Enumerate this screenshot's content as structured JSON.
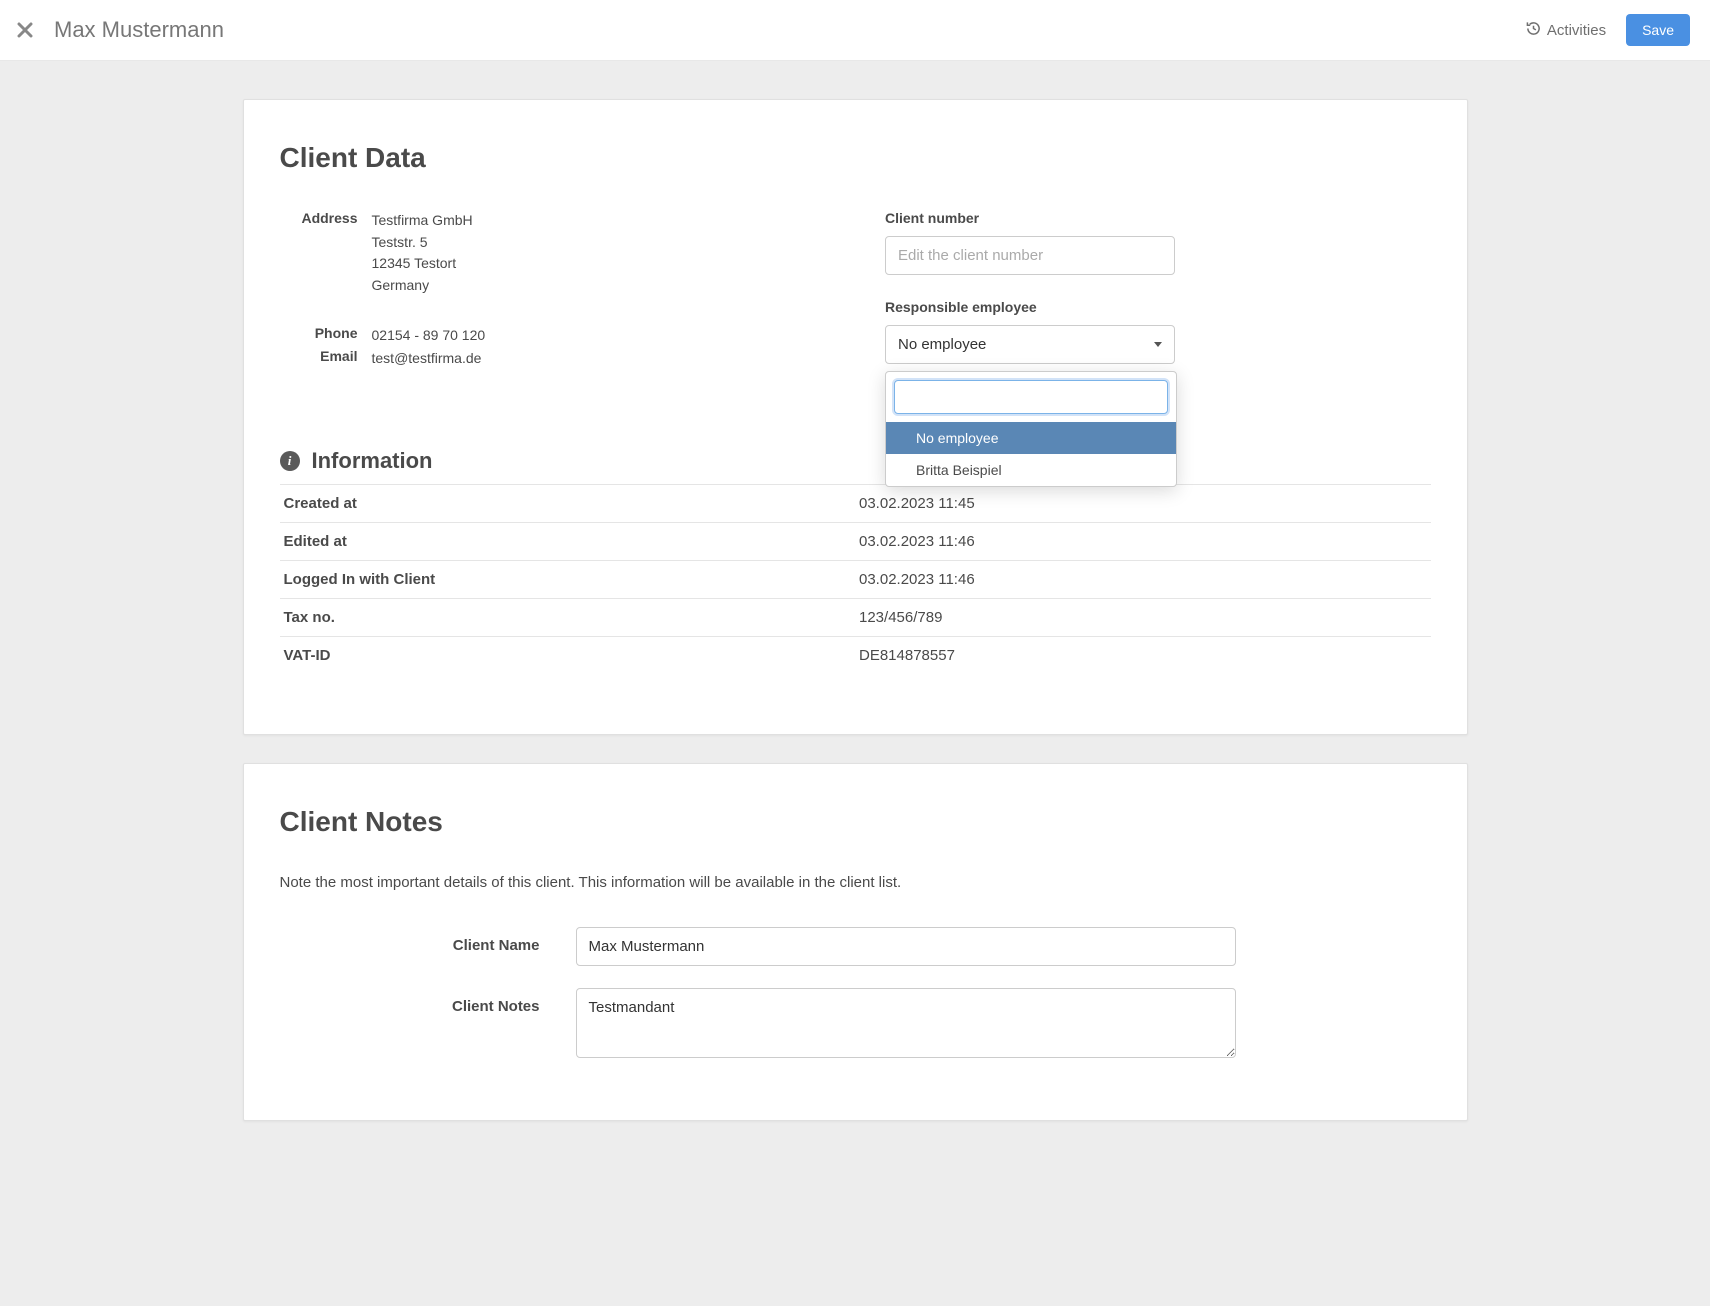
{
  "header": {
    "client_name": "Max Mustermann",
    "activities_label": "Activities",
    "save_label": "Save"
  },
  "client_data": {
    "title": "Client Data",
    "address_label": "Address",
    "address": {
      "company": "Testfirma GmbH",
      "street": "Teststr. 5",
      "city": "12345 Testort",
      "country": "Germany"
    },
    "phone_label": "Phone",
    "phone": "02154 - 89 70 120",
    "email_label": "Email",
    "email": "test@testfirma.de",
    "client_number_label": "Client number",
    "client_number_placeholder": "Edit the client number",
    "client_number_value": "",
    "responsible_label": "Responsible employee",
    "responsible_selected": "No employee",
    "responsible_options": [
      "No employee",
      "Britta Beispiel"
    ]
  },
  "information": {
    "title": "Information",
    "rows": [
      {
        "label": "Created at",
        "value": "03.02.2023 11:45"
      },
      {
        "label": "Edited at",
        "value": "03.02.2023 11:46"
      },
      {
        "label": "Logged In with Client",
        "value": "03.02.2023 11:46"
      },
      {
        "label": "Tax no.",
        "value": "123/456/789"
      },
      {
        "label": "VAT-ID",
        "value": "DE814878557"
      }
    ]
  },
  "notes": {
    "title": "Client Notes",
    "description": "Note the most important details of this client. This information will be available in the client list.",
    "name_label": "Client Name",
    "name_value": "Max Mustermann",
    "notes_label": "Client Notes",
    "notes_value": "Testmandant"
  }
}
